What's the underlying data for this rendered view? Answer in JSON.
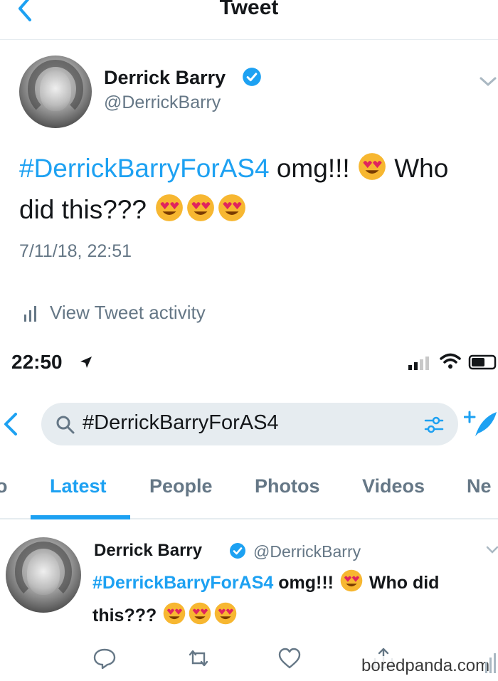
{
  "header": {
    "title": "Tweet"
  },
  "tweet": {
    "author_name": "Derrick Barry",
    "author_handle": "@DerrickBarry",
    "text_hashtag": "#DerrickBarryForAS4",
    "text_after_hashtag": " omg!!! ",
    "text_after_emoji": " Who did this??? ",
    "timestamp": "7/11/18, 22:51",
    "activity_label": "View Tweet activity"
  },
  "status_bar": {
    "time": "22:50"
  },
  "search": {
    "query": "#DerrickBarryForAS4"
  },
  "tabs": [
    {
      "label": "o",
      "active": false
    },
    {
      "label": "Latest",
      "active": true
    },
    {
      "label": "People",
      "active": false
    },
    {
      "label": "Photos",
      "active": false
    },
    {
      "label": "Videos",
      "active": false
    },
    {
      "label": "Ne",
      "active": false
    }
  ],
  "result_tweet": {
    "author_name": "Derrick Barry",
    "author_handle": "@DerrickBarry",
    "text_hashtag": "#DerrickBarryForAS4",
    "text_after_hashtag": " omg!!! ",
    "text_after_emoji": " Who did this??? "
  },
  "watermark": "boredpanda.com",
  "colors": {
    "accent": "#1da1f2",
    "secondary_text": "#657786",
    "emoji_face": "#f7b731",
    "heart_eyes": "#e0245e"
  },
  "icons": [
    "back-icon",
    "verified-icon",
    "chevron-down-icon",
    "bar-chart-icon",
    "location-arrow-icon",
    "signal-icon",
    "wifi-icon",
    "battery-icon",
    "search-icon",
    "filter-icon",
    "compose-icon",
    "reply-icon",
    "retweet-icon",
    "like-icon",
    "share-icon"
  ]
}
